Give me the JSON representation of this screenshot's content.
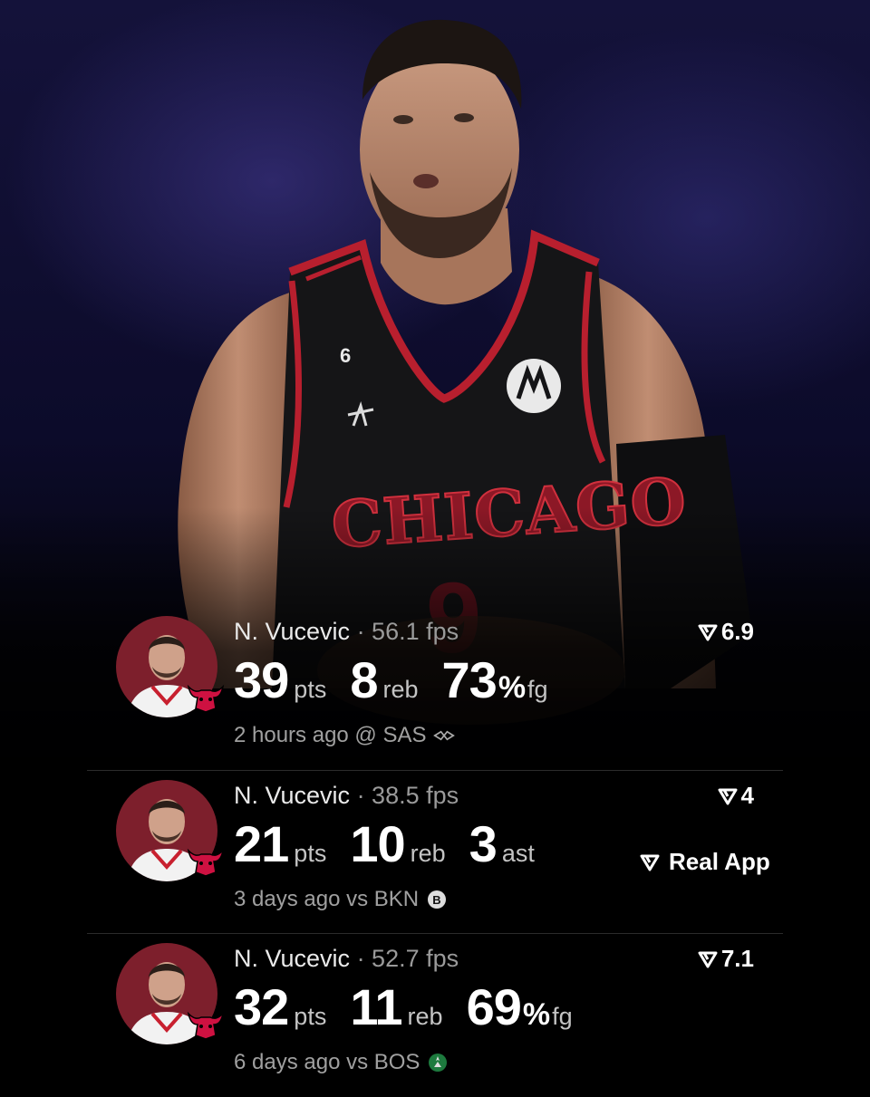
{
  "hero": {
    "jersey_text": "CHICAGO",
    "jersey_number": "9",
    "patch_number": "6"
  },
  "brand": {
    "label": "Real App"
  },
  "games": [
    {
      "player": "N. Vucevic",
      "fps": "· 56.1 fps",
      "score": "6.9",
      "stats": [
        {
          "value": "39",
          "unit": "pts"
        },
        {
          "value": "8",
          "unit": "reb"
        },
        {
          "value": "73",
          "pct": "%",
          "unit": "fg"
        }
      ],
      "when": "2 hours ago @ SAS",
      "opponent_logo": "spurs-logo-icon"
    },
    {
      "player": "N. Vucevic",
      "fps": "· 38.5 fps",
      "score": "4",
      "stats": [
        {
          "value": "21",
          "unit": "pts"
        },
        {
          "value": "10",
          "unit": "reb"
        },
        {
          "value": "3",
          "unit": "ast"
        }
      ],
      "when": "3 days ago vs BKN",
      "opponent_logo": "nets-logo-icon"
    },
    {
      "player": "N. Vucevic",
      "fps": "· 52.7 fps",
      "score": "7.1",
      "stats": [
        {
          "value": "32",
          "unit": "pts"
        },
        {
          "value": "11",
          "unit": "reb"
        },
        {
          "value": "69",
          "pct": "%",
          "unit": "fg"
        }
      ],
      "when": "6 days ago vs BOS",
      "opponent_logo": "celtics-logo-icon"
    }
  ],
  "colors": {
    "avatar_bg": "#7d1f2c",
    "bulls_red": "#ce1141",
    "divider": "#2b2b2b"
  }
}
